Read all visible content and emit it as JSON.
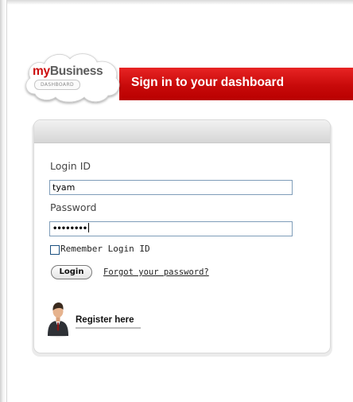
{
  "brand": {
    "logo_prefix": "my",
    "logo_name": "Business",
    "logo_sub": "DASHBOARD",
    "accent_color": "#cc0d0d"
  },
  "banner": {
    "title": "Sign in to your dashboard"
  },
  "login_form": {
    "login_label": "Login ID",
    "login_value": "tyam",
    "password_label": "Password",
    "password_value": "••••••••",
    "remember_label": "Remember Login ID",
    "remember_checked": false,
    "login_button_label": "Login",
    "forgot_link": "Forgot your password?"
  },
  "register": {
    "link_label": "Register here",
    "icon": "user-avatar-icon"
  }
}
